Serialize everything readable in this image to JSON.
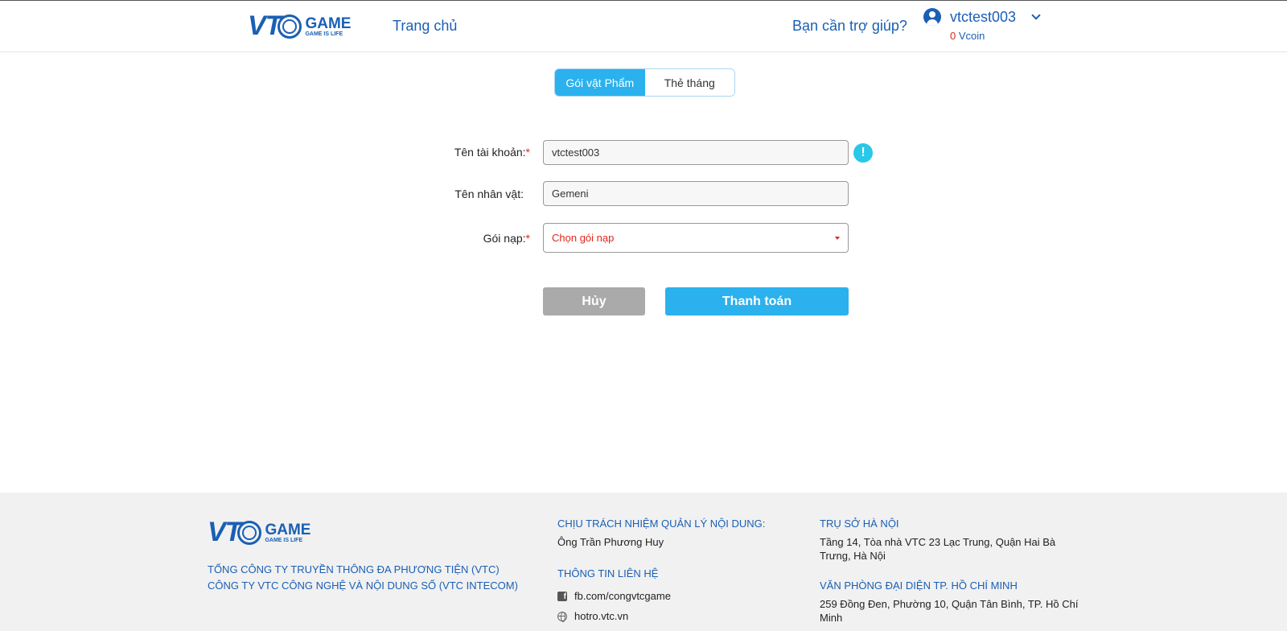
{
  "header": {
    "logo_text": "VTC GAME",
    "logo_tagline": "GAME IS LIFE",
    "nav_home": "Trang chủ",
    "help": "Bạn cần trợ giúp?",
    "username": "vtctest003",
    "vcoin_amount": "0",
    "vcoin_unit": "Vcoin"
  },
  "tabs": [
    {
      "label": "Gói vật Phẩm",
      "active": true
    },
    {
      "label": "Thẻ tháng",
      "active": false
    }
  ],
  "form": {
    "account_label": "Tên tài khoản:",
    "account_value": "vtctest003",
    "character_label": "Tên nhân vật:",
    "character_value": "Gemeni",
    "package_label": "Gói nạp:",
    "package_selected": "Chọn gói nạp",
    "required_mark": "*",
    "info_icon_text": "!"
  },
  "buttons": {
    "cancel": "Hủy",
    "pay": "Thanh toán"
  },
  "footer": {
    "logo_text": "VTC GAME",
    "logo_tagline": "GAME IS LIFE",
    "corp_line1": "TỔNG CÔNG TY TRUYỀN THÔNG ĐA PHƯƠNG TIỆN (VTC)",
    "corp_line2": "CÔNG TY VTC CÔNG NGHỆ VÀ NỘI DUNG SỐ (VTC INTECOM)",
    "resp_heading": "CHỊU TRÁCH NHIỆM QUẢN LÝ NỘI DUNG:",
    "resp_name": "Ông Trần Phương Huy",
    "contact_heading": "THÔNG TIN LIÊN HỆ",
    "facebook": "fb.com/congvtcgame",
    "website": "hotro.vtc.vn",
    "hanoi_heading": "TRỤ SỞ HÀ NỘI",
    "hanoi_address": "Tầng 14, Tòa nhà VTC 23 Lạc Trung, Quận Hai Bà Trưng, Hà Nội",
    "hcm_heading": "VĂN PHÒNG ĐẠI DIỆN TP. HỒ CHÍ MINH",
    "hcm_address": "259 Đồng Đen, Phường 10, Quận Tân Bình, TP. Hồ Chí Minh"
  },
  "colors": {
    "brand_blue": "#1a5fb4",
    "accent_cyan": "#2bb1ee",
    "required_red": "#e0261b",
    "cancel_gray": "#aaaaaa"
  }
}
